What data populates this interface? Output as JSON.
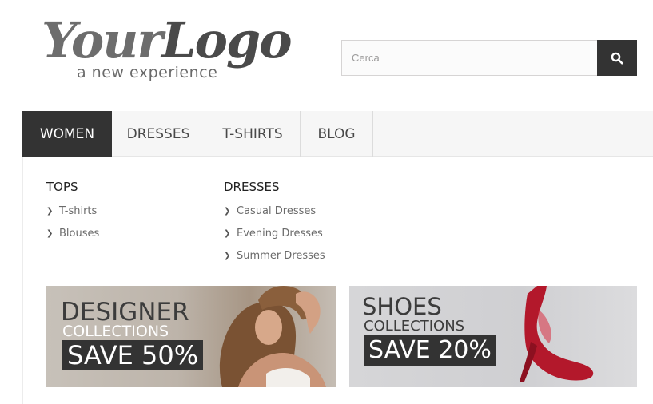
{
  "logo": {
    "text_part1": "Your",
    "text_part2": "Logo",
    "tagline": "a new experience"
  },
  "search": {
    "placeholder": "Cerca",
    "value": "",
    "icon": "search-icon"
  },
  "menu": {
    "tabs": [
      {
        "label": "WOMEN",
        "active": true
      },
      {
        "label": "DRESSES",
        "active": false
      },
      {
        "label": "T-SHIRTS",
        "active": false
      },
      {
        "label": "BLOG",
        "active": false
      }
    ]
  },
  "dropdown": {
    "columns": [
      {
        "title": "TOPS",
        "items": [
          "T-shirts",
          "Blouses"
        ]
      },
      {
        "title": "DRESSES",
        "items": [
          "Casual Dresses",
          "Evening Dresses",
          "Summer Dresses"
        ]
      }
    ],
    "item_icon": "chevron-right-icon"
  },
  "banners": [
    {
      "line1": "DESIGNER",
      "line2": "COLLECTIONS",
      "line3": "SAVE 50%"
    },
    {
      "line1": "SHOES",
      "line2": "COLLECTIONS",
      "line3": "SAVE 20%"
    }
  ],
  "colors": {
    "dark": "#333333",
    "menu_bg": "#f6f6f6",
    "text_gray": "#6a6a6a",
    "shoe_red": "#b3182b"
  }
}
